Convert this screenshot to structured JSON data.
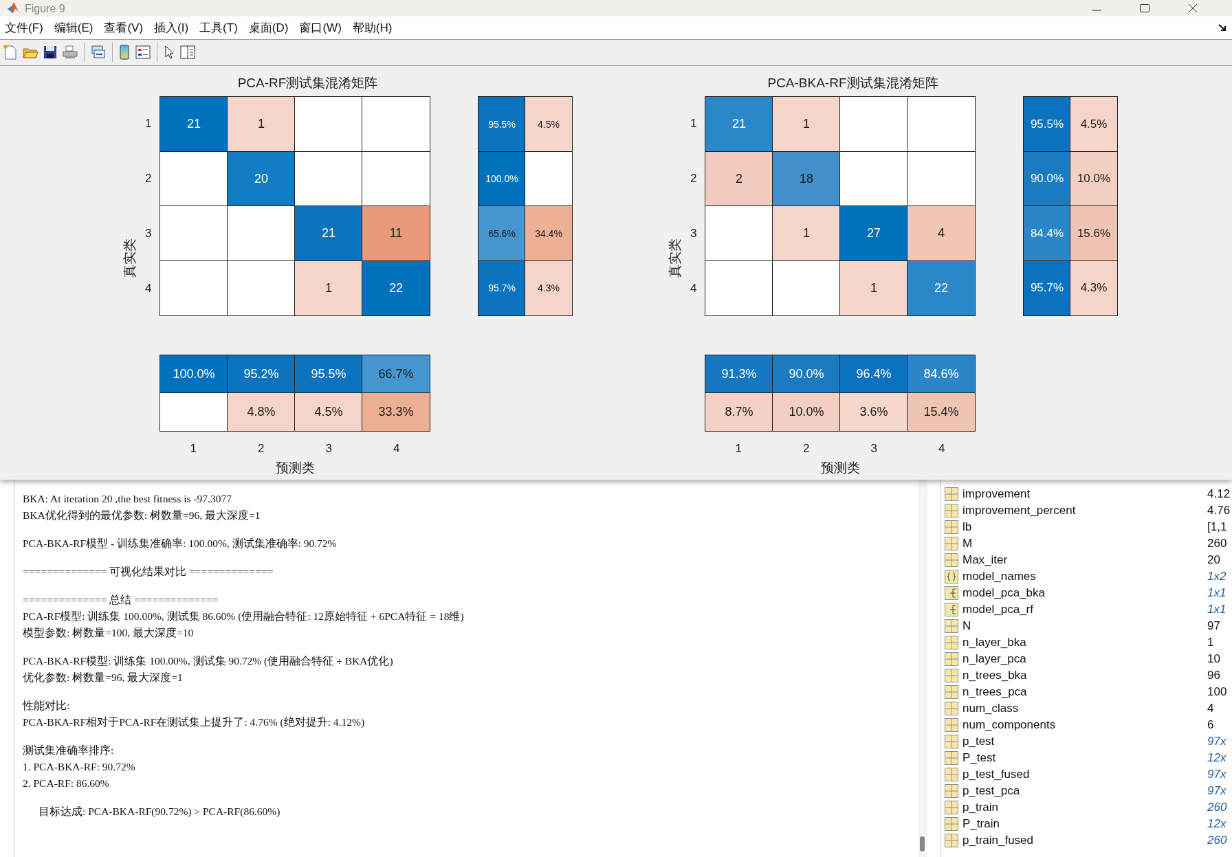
{
  "figure": {
    "title": "Figure 9",
    "menus": [
      "文件(F)",
      "编辑(E)",
      "查看(V)",
      "插入(I)",
      "工具(T)",
      "桌面(D)",
      "窗口(W)",
      "帮助(H)"
    ],
    "toolbar": [
      {
        "kind": "new"
      },
      {
        "kind": "open"
      },
      {
        "kind": "save"
      },
      {
        "kind": "print",
        "separator_after": true
      },
      {
        "kind": "link",
        "separator_after": true
      },
      {
        "kind": "colorbar"
      },
      {
        "kind": "legend",
        "separator_after": true
      },
      {
        "kind": "pointer"
      },
      {
        "kind": "inspector"
      }
    ],
    "panels": [
      {
        "title": "PCA-RF测试集混淆矩阵",
        "y_label": "真实类",
        "x_label": "预测类",
        "row_ticks": [
          "1",
          "2",
          "3",
          "4"
        ],
        "col_ticks": [
          "1",
          "2",
          "3",
          "4"
        ],
        "matrix": [
          [
            {
              "text": "21",
              "color": "#0072bd"
            },
            {
              "text": "1",
              "color": "#f5d5c9"
            },
            {
              "color": "#ffffff"
            },
            {
              "color": "#ffffff"
            }
          ],
          [
            {
              "color": "#ffffff"
            },
            {
              "text": "20",
              "color": "#127cc3"
            },
            {
              "color": "#ffffff"
            },
            {
              "color": "#ffffff"
            }
          ],
          [
            {
              "color": "#ffffff"
            },
            {
              "color": "#ffffff"
            },
            {
              "text": "21",
              "color": "#0b72bd"
            },
            {
              "text": "11",
              "color": "#e8997a"
            }
          ],
          [
            {
              "color": "#ffffff"
            },
            {
              "color": "#ffffff"
            },
            {
              "text": "1",
              "color": "#f5d5c9"
            },
            {
              "text": "22",
              "color": "#0072bd"
            }
          ]
        ],
        "row_summary": [
          [
            {
              "text": "95.5%",
              "color": "#0b72bd"
            },
            {
              "text": "4.5%",
              "color": "#f5d5c9"
            }
          ],
          [
            {
              "text": "100.0%",
              "color": "#0072bd"
            },
            {
              "color": "#ffffff"
            }
          ],
          [
            {
              "text": "65.6%",
              "color": "#4596d0"
            },
            {
              "text": "34.4%",
              "color": "#eeb095"
            }
          ],
          [
            {
              "text": "95.7%",
              "color": "#0b72bd"
            },
            {
              "text": "4.3%",
              "color": "#f5d5c9"
            }
          ]
        ],
        "col_summary": [
          [
            {
              "text": "100.0%",
              "color": "#0072bd"
            },
            {
              "text": "95.2%",
              "color": "#0b72bd"
            },
            {
              "text": "95.5%",
              "color": "#0b72bd"
            },
            {
              "text": "66.7%",
              "color": "#4596d0"
            }
          ],
          [
            {
              "color": "#ffffff"
            },
            {
              "text": "4.8%",
              "color": "#f5d5c9"
            },
            {
              "text": "4.5%",
              "color": "#f5d5c9"
            },
            {
              "text": "33.3%",
              "color": "#edaf93"
            }
          ]
        ]
      },
      {
        "title": "PCA-BKA-RF测试集混淆矩阵",
        "y_label": "真实类",
        "x_label": "预测类",
        "row_ticks": [
          "1",
          "2",
          "3",
          "4"
        ],
        "col_ticks": [
          "1",
          "2",
          "3",
          "4"
        ],
        "matrix": [
          [
            {
              "text": "21",
              "color": "#2b88c8"
            },
            {
              "text": "1",
              "color": "#f5d5c9"
            },
            {
              "color": "#ffffff"
            },
            {
              "color": "#ffffff"
            }
          ],
          [
            {
              "text": "2",
              "color": "#f2cdbf"
            },
            {
              "text": "18",
              "color": "#428fc9"
            },
            {
              "color": "#ffffff"
            },
            {
              "color": "#ffffff"
            }
          ],
          [
            {
              "color": "#ffffff"
            },
            {
              "text": "1",
              "color": "#f5d5c9"
            },
            {
              "text": "27",
              "color": "#0072bd"
            },
            {
              "text": "4",
              "color": "#f2c6b4"
            }
          ],
          [
            {
              "color": "#ffffff"
            },
            {
              "color": "#ffffff"
            },
            {
              "text": "1",
              "color": "#f5d5c9"
            },
            {
              "text": "22",
              "color": "#2b88c8"
            }
          ]
        ],
        "row_summary": [
          [
            {
              "text": "95.5%",
              "color": "#0b72bd"
            },
            {
              "text": "4.5%",
              "color": "#f5d5c9"
            }
          ],
          [
            {
              "text": "90.0%",
              "color": "#1a7bc1"
            },
            {
              "text": "10.0%",
              "color": "#f2cfc1"
            }
          ],
          [
            {
              "text": "84.4%",
              "color": "#2a86c6"
            },
            {
              "text": "15.6%",
              "color": "#f0c4b2"
            }
          ],
          [
            {
              "text": "95.7%",
              "color": "#0b72bd"
            },
            {
              "text": "4.3%",
              "color": "#f5d5c9"
            }
          ]
        ],
        "col_summary": [
          [
            {
              "text": "91.3%",
              "color": "#1678c0"
            },
            {
              "text": "90.0%",
              "color": "#1a7bc1"
            },
            {
              "text": "96.4%",
              "color": "#0b72bd"
            },
            {
              "text": "84.6%",
              "color": "#2a86c6"
            }
          ],
          [
            {
              "text": "8.7%",
              "color": "#f3d2c5"
            },
            {
              "text": "10.0%",
              "color": "#f2cfc1"
            },
            {
              "text": "3.6%",
              "color": "#f6d8cd"
            },
            {
              "text": "15.4%",
              "color": "#f0c4b2"
            }
          ]
        ]
      }
    ]
  },
  "console": {
    "blocks": [
      {
        "lines": [
          {
            "text": "BKA: At iteration 20 ,the best fitness is -97.3077",
            "indent": false
          },
          {
            "text": "BKA优化得到的最优参数: 树数量=96, 最大深度=1",
            "indent": false
          }
        ]
      },
      {
        "lines": [
          {
            "text": "PCA-BKA-RF模型 - 训练集准确率: 100.00%, 测试集准确率: 90.72%",
            "indent": false
          }
        ]
      },
      {
        "lines": [
          {
            "text": "============== 可视化结果对比 ==============",
            "indent": false
          }
        ]
      },
      {
        "lines": [
          {
            "text": "============== 总结 ==============",
            "indent": false
          },
          {
            "text": "PCA-RF模型: 训练集 100.00%, 测试集 86.60% (使用融合特征: 12原始特征 + 6PCA特征 = 18维)",
            "indent": false
          },
          {
            "text": "模型参数: 树数量=100, 最大深度=10",
            "indent": false
          }
        ]
      },
      {
        "lines": [
          {
            "text": "PCA-BKA-RF模型: 训练集 100.00%, 测试集 90.72% (使用融合特征 + BKA优化)",
            "indent": false
          },
          {
            "text": "优化参数: 树数量=96, 最大深度=1",
            "indent": false
          }
        ]
      },
      {
        "lines": [
          {
            "text": "性能对比:",
            "indent": false
          },
          {
            "text": "PCA-BKA-RF相对于PCA-RF在测试集上提升了: 4.76% (绝对提升: 4.12%)",
            "indent": false
          }
        ]
      },
      {
        "lines": [
          {
            "text": "测试集准确率排序:",
            "indent": false
          },
          {
            "text": "1. PCA-BKA-RF: 90.72%",
            "indent": false
          },
          {
            "text": "2. PCA-RF: 86.60%",
            "indent": false
          }
        ]
      },
      {
        "lines": [
          {
            "text": "目标达成: PCA-BKA-RF(90.72%) > PCA-RF(86.60%)",
            "indent": true
          }
        ]
      }
    ]
  },
  "workspace": {
    "rows": [
      {
        "name": "improvement",
        "value": "4.12",
        "kind": "matrix",
        "size_only": false
      },
      {
        "name": "improvement_percent",
        "value": "4.76",
        "kind": "matrix",
        "size_only": false
      },
      {
        "name": "lb",
        "value": "[1,1",
        "kind": "matrix",
        "size_only": false
      },
      {
        "name": "M",
        "value": "260",
        "kind": "matrix",
        "size_only": false
      },
      {
        "name": "Max_iter",
        "value": "20",
        "kind": "matrix",
        "size_only": false
      },
      {
        "name": "model_names",
        "value": "1x2",
        "kind": "cell",
        "size_only": true
      },
      {
        "name": "model_pca_bka",
        "value": "1x1",
        "kind": "object",
        "size_only": true
      },
      {
        "name": "model_pca_rf",
        "value": "1x1",
        "kind": "object",
        "size_only": true
      },
      {
        "name": "N",
        "value": "97",
        "kind": "matrix",
        "size_only": false
      },
      {
        "name": "n_layer_bka",
        "value": "1",
        "kind": "matrix",
        "size_only": false
      },
      {
        "name": "n_layer_pca",
        "value": "10",
        "kind": "matrix",
        "size_only": false
      },
      {
        "name": "n_trees_bka",
        "value": "96",
        "kind": "matrix",
        "size_only": false
      },
      {
        "name": "n_trees_pca",
        "value": "100",
        "kind": "matrix",
        "size_only": false
      },
      {
        "name": "num_class",
        "value": "4",
        "kind": "matrix",
        "size_only": false
      },
      {
        "name": "num_components",
        "value": "6",
        "kind": "matrix",
        "size_only": false
      },
      {
        "name": "p_test",
        "value": "97x",
        "kind": "matrix",
        "size_only": true
      },
      {
        "name": "P_test",
        "value": "12x",
        "kind": "matrix",
        "size_only": true
      },
      {
        "name": "p_test_fused",
        "value": "97x",
        "kind": "matrix",
        "size_only": true
      },
      {
        "name": "p_test_pca",
        "value": "97x",
        "kind": "matrix",
        "size_only": true
      },
      {
        "name": "p_train",
        "value": "260",
        "kind": "matrix",
        "size_only": true
      },
      {
        "name": "P_train",
        "value": "12x",
        "kind": "matrix",
        "size_only": true
      },
      {
        "name": "p_train_fused",
        "value": "260",
        "kind": "matrix",
        "size_only": true
      }
    ]
  }
}
